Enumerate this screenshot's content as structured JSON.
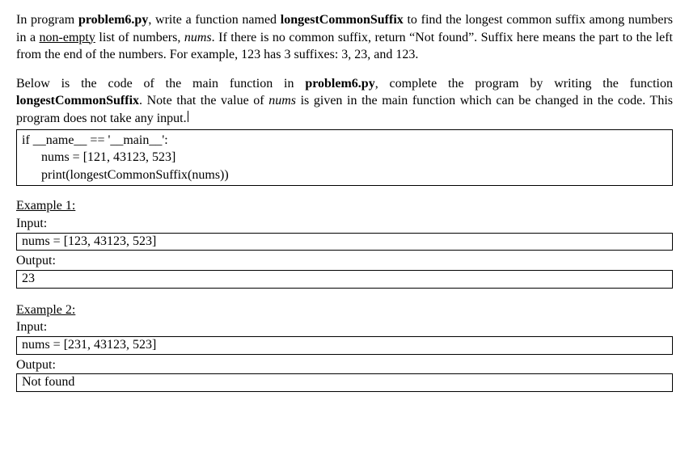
{
  "intro": {
    "pre1": "In program ",
    "filename": "problem6.py",
    "post1": ", write a function named ",
    "funcname": "longestCommonSuffix",
    "post2": " to find the longest common suffix among numbers in a ",
    "nonempty": "non-empty",
    "post3": " list of numbers, ",
    "nums_italic": "nums",
    "post4": ". If there is no common suffix, return “Not found”. Suffix here means the part to the left from the end of the numbers. For example, 123 has 3 suffixes: 3, 23, and 123."
  },
  "para2": {
    "pre1": "Below is the code of the main function in ",
    "filename": "problem6.py",
    "post1": ", complete the program by writing the function ",
    "funcname": "longestCommonSuffix",
    "post2": ". Note that the value of ",
    "nums_italic": "nums",
    "post3": " is given in the main function which can be changed in the code. This program does not take any input."
  },
  "code": {
    "line1": "if __name__ == '__main__':",
    "line2": "nums = [121, 43123, 523]",
    "line3": "print(longestCommonSuffix(nums))"
  },
  "ex1": {
    "title": "Example 1:",
    "input_label": "Input:",
    "input_val": "nums = [123, 43123, 523]",
    "output_label": "Output:",
    "output_val": "23"
  },
  "ex2": {
    "title": "Example 2:",
    "input_label": "Input:",
    "input_val": "nums = [231, 43123, 523]",
    "output_label": "Output:",
    "output_val": "Not found"
  }
}
